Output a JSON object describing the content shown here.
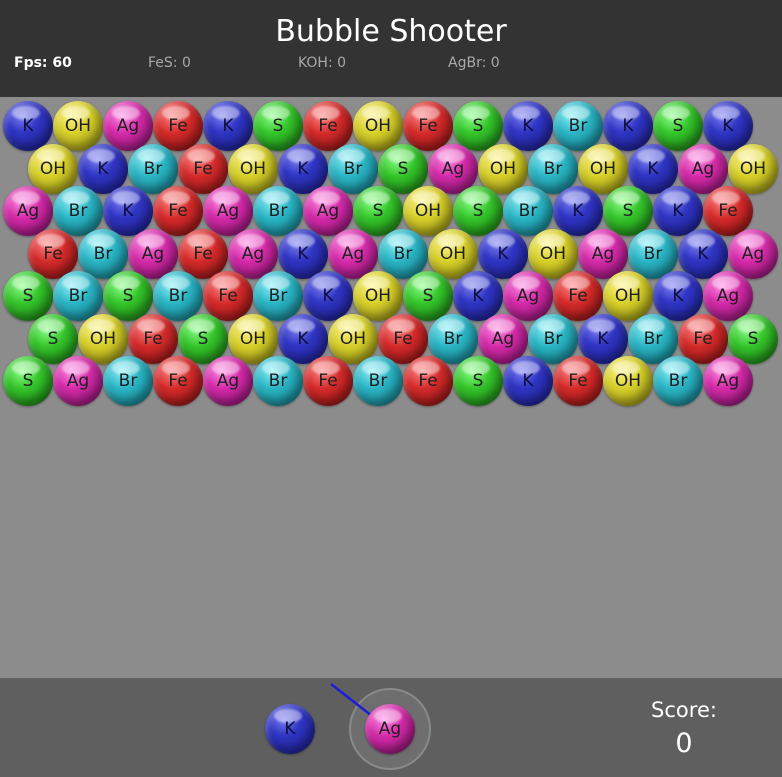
{
  "app": {
    "title": "Bubble Shooter"
  },
  "stats": {
    "fps": "Fps: 60",
    "fes": "FeS: 0",
    "koh": "KOH: 0",
    "agbr": "AgBr: 0"
  },
  "grid": {
    "rows": [
      [
        "K",
        "OH",
        "Ag",
        "Fe",
        "K",
        "S",
        "Fe",
        "OH",
        "Fe",
        "S",
        "K",
        "Br",
        "K",
        "S",
        "K"
      ],
      [
        "OH",
        "K",
        "Br",
        "Fe",
        "OH",
        "K",
        "Br",
        "S",
        "Ag",
        "OH",
        "Br",
        "OH",
        "K",
        "Ag",
        "OH"
      ],
      [
        "Ag",
        "Br",
        "K",
        "Fe",
        "Ag",
        "Br",
        "Ag",
        "S",
        "OH",
        "S",
        "Br",
        "K",
        "S",
        "K",
        "Fe"
      ],
      [
        "Fe",
        "Br",
        "Ag",
        "Fe",
        "Ag",
        "K",
        "Ag",
        "Br",
        "OH",
        "K",
        "OH",
        "Ag",
        "Br",
        "K",
        "Ag"
      ],
      [
        "S",
        "Br",
        "S",
        "Br",
        "Fe",
        "Br",
        "K",
        "OH",
        "S",
        "K",
        "Ag",
        "Fe",
        "OH",
        "K",
        "Ag"
      ],
      [
        "S",
        "OH",
        "Fe",
        "S",
        "OH",
        "K",
        "OH",
        "Fe",
        "Br",
        "Ag",
        "Br",
        "K",
        "Br",
        "Fe",
        "S"
      ],
      [
        "S",
        "Ag",
        "Br",
        "Fe",
        "Ag",
        "Br",
        "Fe",
        "Br",
        "Fe",
        "S",
        "K",
        "Fe",
        "OH",
        "Br",
        "Ag"
      ]
    ]
  },
  "shooter": {
    "next": "K",
    "current": "Ag"
  },
  "score": {
    "label": "Score:",
    "value": "0"
  },
  "colors": {
    "header_bg": "#333333",
    "board_bg": "#8c8c8c",
    "footer_bg": "#5f5f5f",
    "aim_line": "#1a1fd6"
  }
}
